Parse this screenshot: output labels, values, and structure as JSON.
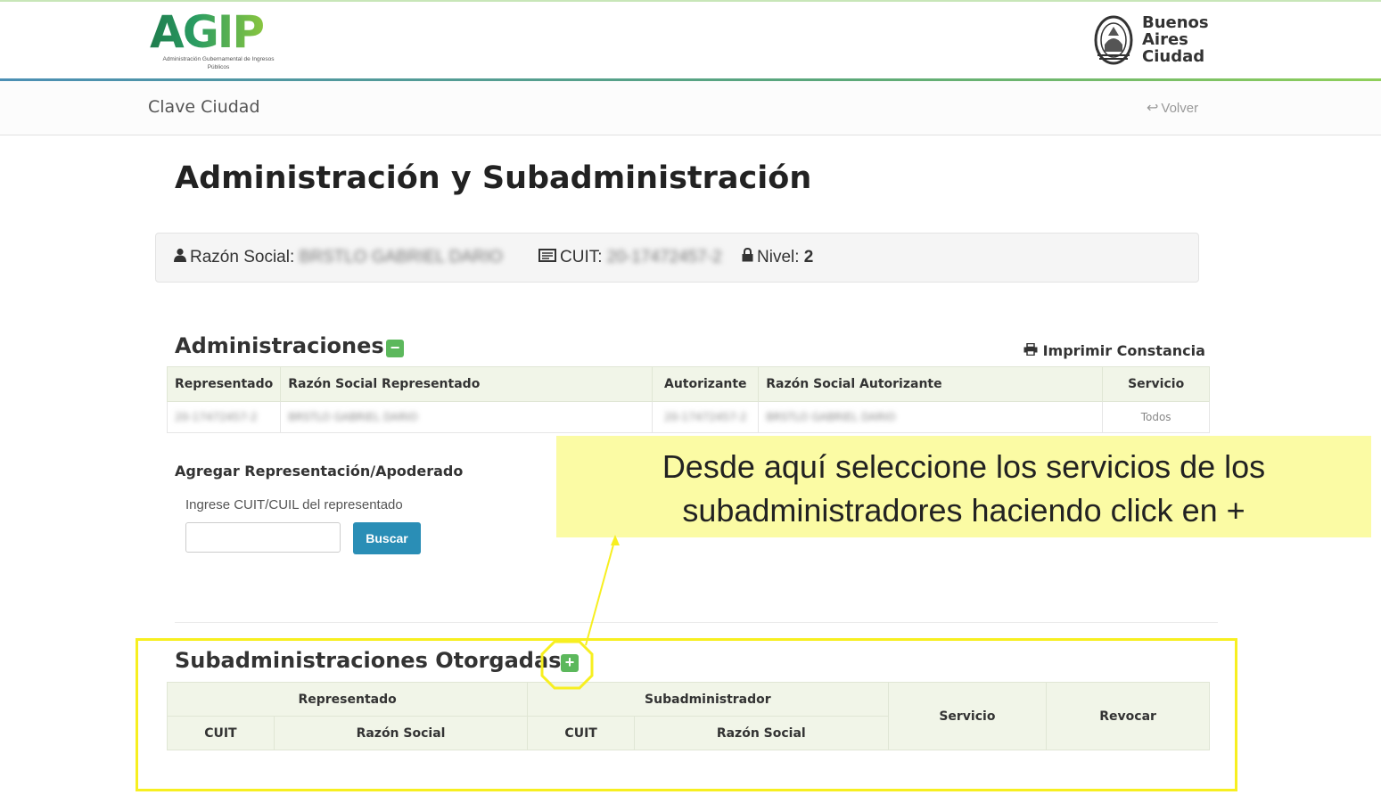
{
  "header": {
    "logo_text": "AGIP",
    "logo_subtitle": "Administración Gubernamental de Ingresos Públicos",
    "city_logo_lines": [
      "Buenos",
      "Aires",
      "Ciudad"
    ]
  },
  "subnav": {
    "title": "Clave Ciudad",
    "back_label": "Volver"
  },
  "page_title": "Administración y Subadministración",
  "info": {
    "razon_label": "Razón Social:",
    "razon_value": "BRSTLO GABRIEL DARIO",
    "cuit_label": "CUIT:",
    "cuit_value": "20-17472457-2",
    "nivel_label": "Nivel:",
    "nivel_value": "2"
  },
  "administraciones": {
    "title": "Administraciones",
    "toggle_symbol": "−",
    "print_label": "Imprimir Constancia",
    "columns": [
      "Representado",
      "Razón Social Representado",
      "Autorizante",
      "Razón Social Autorizante",
      "Servicio"
    ],
    "rows": [
      [
        "20-17472457-2",
        "BRSTLO GABRIEL DARIO",
        "20-17472457-2",
        "BRSTLO GABRIEL DARIO",
        "Todos"
      ]
    ]
  },
  "agregar": {
    "title": "Agregar Representación/Apoderado",
    "input_label": "Ingrese CUIT/CUIL del representado",
    "input_value": "",
    "button_label": "Buscar"
  },
  "subadministraciones": {
    "title": "Subadministraciones Otorgadas",
    "add_symbol": "+",
    "group_representado": "Representado",
    "group_subadministrador": "Subadministrador",
    "col_servicio": "Servicio",
    "col_revocar": "Revocar",
    "col_cuit": "CUIT",
    "col_razon": "Razón Social"
  },
  "callout": {
    "line1": "Desde aquí seleccione los servicios de los",
    "line2": "subadministradores haciendo click en +"
  },
  "colors": {
    "accent_green": "#5cb85c",
    "button_blue": "#2a8eb6",
    "highlight_yellow": "#f7ef20",
    "callout_bg": "#fbfba4"
  }
}
